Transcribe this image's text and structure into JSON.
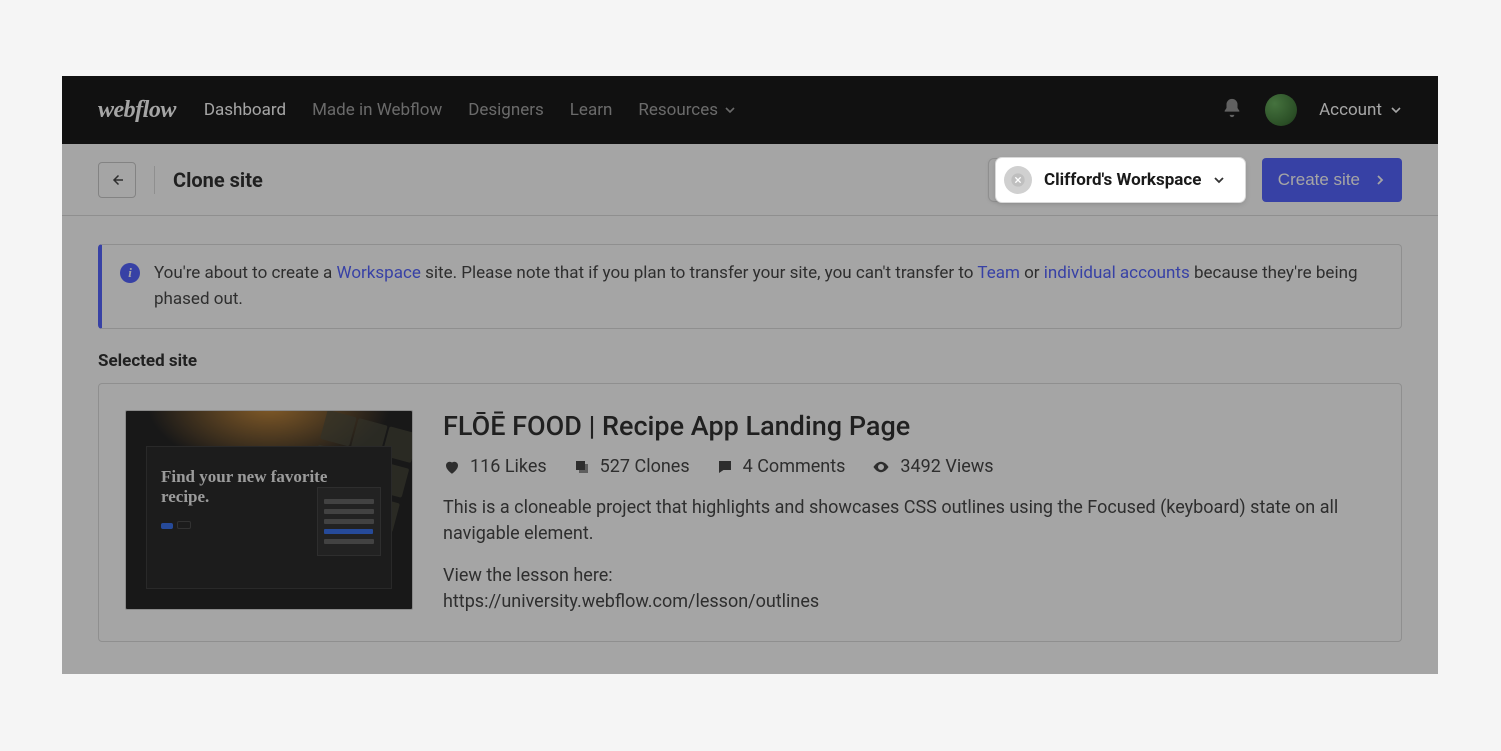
{
  "header": {
    "logo": "webflow",
    "nav": {
      "dashboard": "Dashboard",
      "made": "Made in Webflow",
      "designers": "Designers",
      "learn": "Learn",
      "resources": "Resources"
    },
    "account": "Account"
  },
  "subheader": {
    "title": "Clone site",
    "workspace": "Clifford's Workspace",
    "create": "Create site"
  },
  "notice": {
    "pre": "You're about to create a ",
    "workspace_link": "Workspace",
    "mid1": " site. Please note that if you plan to transfer your site, you can't transfer to ",
    "team_link": "Team",
    "mid2": " or ",
    "individual_link": "individual accounts",
    "post": " because they're being phased out."
  },
  "section_label": "Selected site",
  "site": {
    "thumb_headline": "Find your new favorite recipe.",
    "title": "FLŌĒ FOOD | Recipe App Landing Page",
    "likes": "116 Likes",
    "clones": "527 Clones",
    "comments": "4 Comments",
    "views": "3492 Views",
    "desc": "This is a cloneable project that highlights and showcases CSS outlines using the Focused (keyboard) state on all navigable element.",
    "lesson_label": "View the lesson here:",
    "lesson_url": "https://university.webflow.com/lesson/outlines"
  }
}
